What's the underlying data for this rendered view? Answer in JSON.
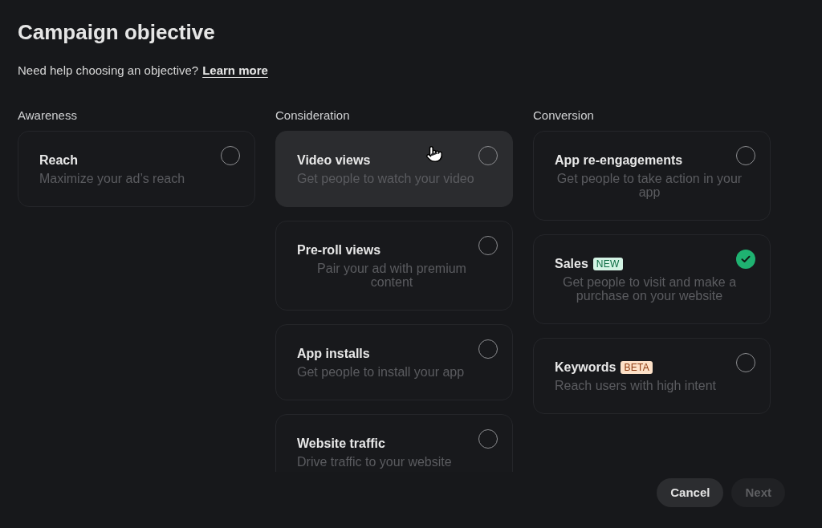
{
  "title": "Campaign objective",
  "help": {
    "text": "Need help choosing an objective?",
    "link": "Learn more"
  },
  "columns": [
    {
      "heading": "Awareness",
      "options": [
        {
          "title": "Reach",
          "description": "Maximize your ad’s reach",
          "selected": false,
          "hovered": false
        }
      ]
    },
    {
      "heading": "Consideration",
      "options": [
        {
          "title": "Video views",
          "description": "Get people to watch your video",
          "selected": false,
          "hovered": true
        },
        {
          "title": "Pre-roll views",
          "description": "Pair your ad with premium content",
          "selected": false,
          "hovered": false
        },
        {
          "title": "App installs",
          "description": "Get people to install your app",
          "selected": false,
          "hovered": false
        },
        {
          "title": "Website traffic",
          "description": "Drive traffic to your website",
          "selected": false,
          "hovered": false
        }
      ]
    },
    {
      "heading": "Conversion",
      "options": [
        {
          "title": "App re-engagements",
          "description": "Get people to take action in your app",
          "selected": false,
          "hovered": false
        },
        {
          "title": "Sales",
          "badge": {
            "label": "NEW",
            "kind": "new"
          },
          "description": "Get people to visit and make a purchase on your website",
          "selected": true,
          "hovered": false
        },
        {
          "title": "Keywords",
          "badge": {
            "label": "BETA",
            "kind": "beta"
          },
          "description": "Reach users with high intent",
          "selected": false,
          "hovered": false
        }
      ]
    }
  ],
  "buttons": [
    {
      "label": "Cancel",
      "disabled": false
    },
    {
      "label": "Next",
      "disabled": true
    }
  ]
}
